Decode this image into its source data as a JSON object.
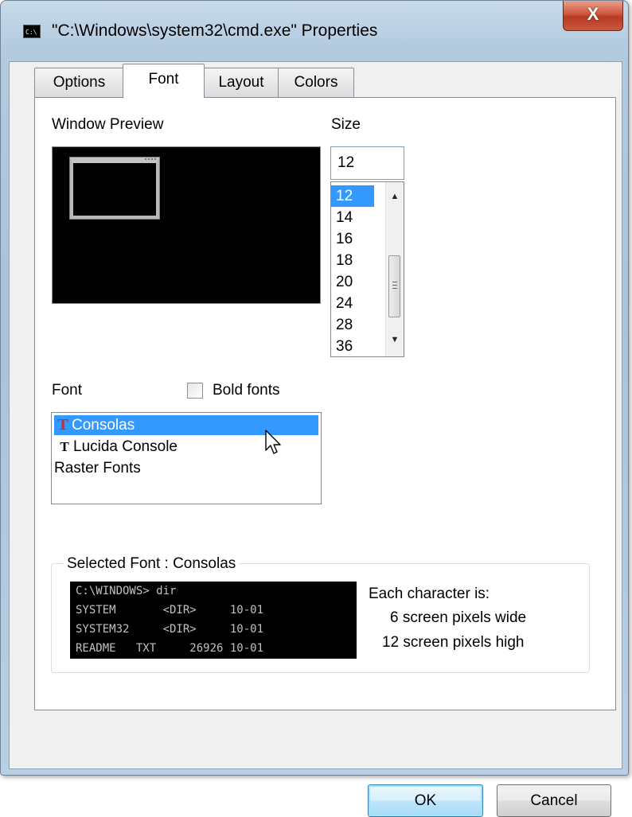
{
  "window": {
    "title": "\"C:\\Windows\\system32\\cmd.exe\" Properties",
    "icon": "cmd-icon",
    "icon_text": "C:\\",
    "close_label": "X"
  },
  "tabs": [
    {
      "label": "Options",
      "active": false
    },
    {
      "label": "Font",
      "active": true
    },
    {
      "label": "Layout",
      "active": false
    },
    {
      "label": "Colors",
      "active": false
    }
  ],
  "preview": {
    "label": "Window Preview"
  },
  "size": {
    "label": "Size",
    "value": "12",
    "options": [
      "12",
      "14",
      "16",
      "18",
      "20",
      "24",
      "28",
      "36"
    ],
    "selected": "12"
  },
  "font": {
    "label": "Font",
    "bold_label": "Bold fonts",
    "bold_checked": false,
    "items": [
      {
        "label": "Consolas",
        "icon": "truetype-icon",
        "selected": true
      },
      {
        "label": "Lucida Console",
        "icon": "truetype-icon",
        "selected": false
      },
      {
        "label": "Raster Fonts",
        "icon": "",
        "selected": false
      }
    ]
  },
  "selected_font": {
    "title": "Selected Font : Consolas",
    "sample_lines": [
      "C:\\WINDOWS> dir",
      "SYSTEM       <DIR>     10-01",
      "SYSTEM32     <DIR>     10-01",
      "README   TXT     26926 10-01"
    ],
    "info_heading": "Each character is:",
    "width_text": "6 screen pixels wide",
    "height_text": "12 screen pixels high"
  },
  "buttons": {
    "ok": "OK",
    "cancel": "Cancel"
  },
  "colors": {
    "selection": "#3399ff",
    "close_button": "#c9583f",
    "console_bg": "#000000",
    "console_text": "#c0c0c0"
  }
}
